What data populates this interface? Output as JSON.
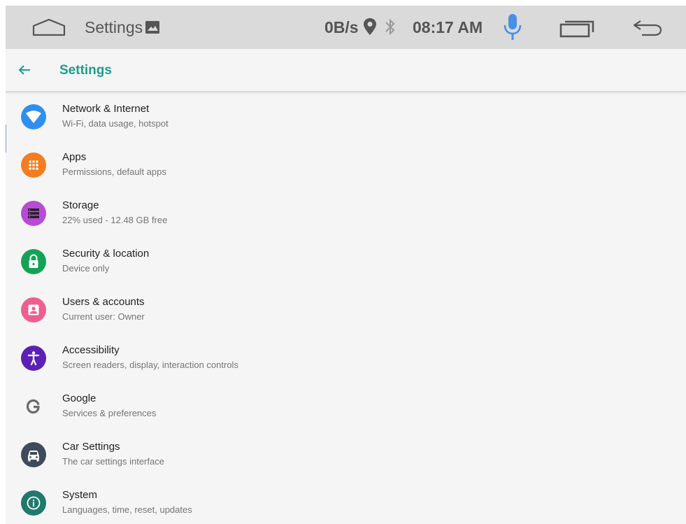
{
  "statusbar": {
    "app_title": "Settings",
    "net_speed": "0B/s",
    "time": "08:17 AM",
    "icons": {
      "home": "home-icon",
      "photo": "photo-icon",
      "location": "location-pin-icon",
      "bluetooth": "bluetooth-icon",
      "mic": "microphone-icon",
      "recents": "recent-apps-icon",
      "back": "back-arrow-icon"
    },
    "mic_color": "#4a90e2"
  },
  "appbar": {
    "title": "Settings",
    "back_icon": "arrow-left-icon",
    "accent": "#1a9e8e"
  },
  "items": [
    {
      "title": "Network & Internet",
      "subtitle": "Wi-Fi, data usage, hotspot",
      "icon": "wifi-icon",
      "color": "#2f8ff0"
    },
    {
      "title": "Apps",
      "subtitle": "Permissions, default apps",
      "icon": "apps-grid-icon",
      "color": "#f57c1f"
    },
    {
      "title": "Storage",
      "subtitle": "22% used - 12.48 GB free",
      "icon": "storage-icon",
      "color": "#b84bd6"
    },
    {
      "title": "Security & location",
      "subtitle": "Device only",
      "icon": "lock-icon",
      "color": "#13a356"
    },
    {
      "title": "Users & accounts",
      "subtitle": "Current user: Owner",
      "icon": "user-icon",
      "color": "#ec5f8e"
    },
    {
      "title": "Accessibility",
      "subtitle": "Screen readers, display, interaction controls",
      "icon": "accessibility-icon",
      "color": "#5b21b6"
    },
    {
      "title": "Google",
      "subtitle": "Services & preferences",
      "icon": "google-icon",
      "color": "#6b6b6b"
    },
    {
      "title": "Car Settings",
      "subtitle": "The car settings interface",
      "icon": "car-icon",
      "color": "#3f4a5c"
    },
    {
      "title": "System",
      "subtitle": "Languages, time, reset, updates",
      "icon": "info-icon",
      "color": "#1f7a6b"
    }
  ]
}
